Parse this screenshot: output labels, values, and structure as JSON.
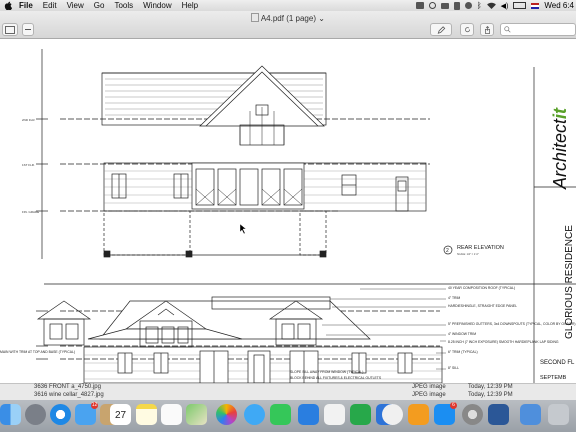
{
  "menubar": {
    "items": [
      "File",
      "Edit",
      "View",
      "Go",
      "Tools",
      "Window",
      "Help"
    ],
    "clock": "Wed 6:4"
  },
  "window": {
    "title": "A4.pdf (1 page)",
    "title_chevron": "⌄"
  },
  "drawing": {
    "rear_elevation": {
      "label": "REAR ELEVATION",
      "marker": "2",
      "scale": "SCALE: 1/4\" = 1'-0\""
    },
    "front_notes": [
      "40 YEAR COMPOSITION ROOF (TYPICAL)",
      "4\" TRIM",
      "HARDIESHINGLE, STRAIGHT EDGE PANEL",
      "5\" PREFINISHED GUTTERS, 3x4 DOWNSPOUTS (TYPICAL, COLOR BY OWNER)",
      "4\" WINDOW TRIM",
      "8.25 INCH (7 INCH EXPOSURE) SMOOTH HARDIEPLANK LAP SIDING",
      "6\" TRIM (TYPICAL)",
      "8\" SILL"
    ],
    "left_note": "MAIN WITH TRIM AT TOP AND BASE (TYPICAL)",
    "bottom_notes": [
      "BLOCK BEHIND ALL FIXTURES & ELECTRICAL OUTLETS",
      "SLOPE SILL AWAY FROM WINDOW (TYPICAL)"
    ],
    "level_labels": [
      "2ND FLR.",
      "1ST FLR.",
      "FIN. GRADE"
    ],
    "title_block": {
      "brand": "Architect",
      "brand_accent": "it",
      "project": "GLORIOUS RESIDENCE",
      "sheet_label": "SECOND FL",
      "date": "SEPTEMB"
    }
  },
  "finder_rows": [
    {
      "name": "3636 FRONT a_4750.jpg",
      "kind": "JPEG image",
      "date": "Today, 12:39 PM"
    },
    {
      "name": "3616 wine cellar_4827.jpg",
      "kind": "JPEG image",
      "date": "Today, 12:39 PM"
    }
  ],
  "dock": {
    "apps": [
      "finder",
      "launchpad",
      "safari",
      "mail",
      "contacts",
      "calendar",
      "notes",
      "reminders",
      "maps",
      "photos",
      "messages",
      "facetime",
      "itunes",
      "ibooks",
      "app-store",
      "system-preferences",
      "microsoft-word",
      "downloads"
    ],
    "calendar_day": "27",
    "badges": {
      "mail": "12",
      "app-store": "6"
    }
  }
}
